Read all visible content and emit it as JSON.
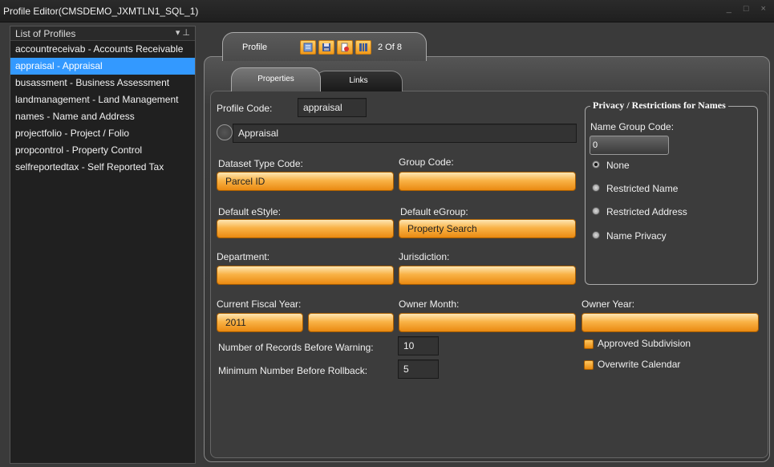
{
  "window": {
    "title": "Profile Editor(CMSDEMO_JXMTLN1_SQL_1)",
    "controls": "_ □ ×"
  },
  "profiles_panel": {
    "header": "List of Profiles",
    "header_controls": "▾ ⊥",
    "items": [
      {
        "label": "accountreceivab - Accounts Receivable",
        "selected": false
      },
      {
        "label": "appraisal - Appraisal",
        "selected": true
      },
      {
        "label": "busassment - Business Assessment",
        "selected": false
      },
      {
        "label": "landmanagement - Land Management",
        "selected": false
      },
      {
        "label": "names - Name and Address",
        "selected": false
      },
      {
        "label": "projectfolio - Project / Folio",
        "selected": false
      },
      {
        "label": "propcontrol - Property Control",
        "selected": false
      },
      {
        "label": "selfreportedtax - Self Reported Tax",
        "selected": false
      }
    ]
  },
  "profile_tab": {
    "label": "Profile",
    "counter": "2 Of 8",
    "toolbar_icons": [
      "properties-icon",
      "save-icon",
      "delete-icon",
      "columns-icon"
    ]
  },
  "subtabs": {
    "properties": "Properties",
    "links": "Links"
  },
  "form": {
    "profile_code_label": "Profile Code:",
    "profile_code_value": "appraisal",
    "description_value": "Appraisal",
    "dataset_type_label": "Dataset Type Code:",
    "dataset_type_value": "Parcel ID",
    "group_code_label": "Group Code:",
    "group_code_value": "",
    "default_estyle_label": "Default eStyle:",
    "default_estyle_value": "",
    "default_egroup_label": "Default eGroup:",
    "default_egroup_value": "Property Search",
    "department_label": "Department:",
    "department_value": "",
    "jurisdiction_label": "Jurisdiction:",
    "jurisdiction_value": "",
    "fiscal_year_label": "Current Fiscal Year:",
    "fiscal_year_value": "2011",
    "fiscal_year_second_value": "",
    "owner_month_label": "Owner Month:",
    "owner_month_value": "",
    "owner_year_label": "Owner Year:",
    "owner_year_value": "",
    "records_warning_label": "Number of Records Before Warning:",
    "records_warning_value": "10",
    "min_rollback_label": "Minimum Number Before Rollback:",
    "min_rollback_value": "5",
    "approved_subdivision_label": "Approved Subdivision",
    "overwrite_calendar_label": "Overwrite Calendar"
  },
  "privacy": {
    "legend": "Privacy / Restrictions for Names",
    "name_group_label": "Name Group Code:",
    "name_group_value": "0",
    "options": [
      {
        "label": "None",
        "checked": true
      },
      {
        "label": "Restricted Name",
        "checked": false
      },
      {
        "label": "Restricted Address",
        "checked": false
      },
      {
        "label": "Name Privacy",
        "checked": false
      }
    ]
  },
  "colors": {
    "accent_orange": "#f19a1b",
    "selection_blue": "#3399ff",
    "panel_dark": "#202020"
  }
}
